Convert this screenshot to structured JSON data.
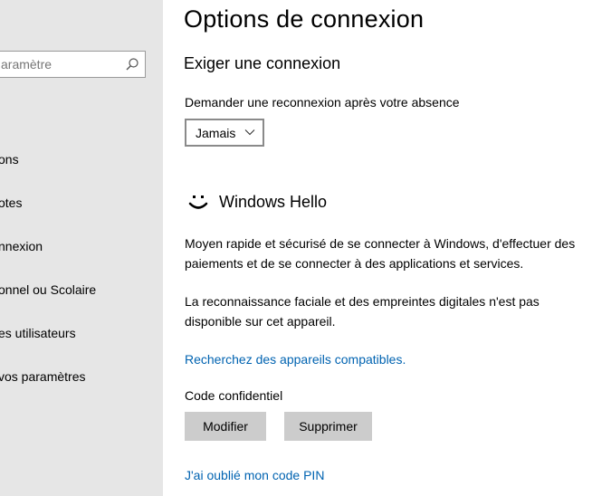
{
  "sidebar": {
    "search": {
      "placeholder": "Rechercher un paramètre",
      "visible_text": "aramètre",
      "icon": "search-icon"
    },
    "items": [
      {
        "label": "ons"
      },
      {
        "label": "otes"
      },
      {
        "label": "nnexion"
      },
      {
        "label": "onnel ou Scolaire"
      },
      {
        "label": "es utilisateurs"
      },
      {
        "label": "vos paramètres"
      }
    ]
  },
  "main": {
    "title": "Options de connexion",
    "require_signin": {
      "title": "Exiger une connexion",
      "label": "Demander une reconnexion après votre absence",
      "dropdown_value": "Jamais"
    },
    "windows_hello": {
      "icon": "smile-icon",
      "title": "Windows Hello",
      "description": "Moyen rapide et sécurisé de se connecter à Windows, d'effectuer des paiements et de se connecter à des applications et services.",
      "unavailable": "La reconnaissance faciale et des empreintes digitales n'est pas disponible sur cet appareil.",
      "compatible_link": "Recherchez des appareils compatibles."
    },
    "pin": {
      "label": "Code confidentiel",
      "modify_label": "Modifier",
      "delete_label": "Supprimer",
      "forgot_link": "J'ai oublié mon code PIN"
    }
  },
  "colors": {
    "sidebar_bg": "#e6e6e6",
    "link": "#0063b1",
    "button_bg": "#cccccc"
  }
}
